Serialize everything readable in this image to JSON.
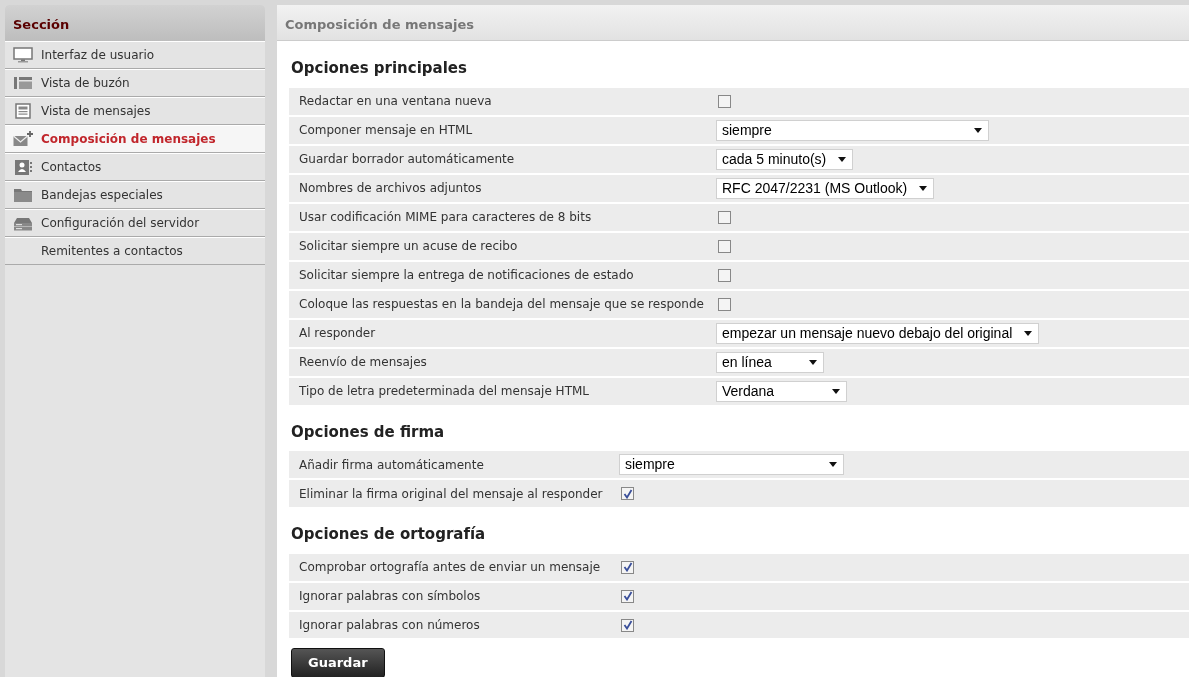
{
  "sidebar": {
    "title": "Sección",
    "items": [
      {
        "label": "Interfaz de usuario",
        "kind": "monitor",
        "selected": false
      },
      {
        "label": "Vista de buzón",
        "kind": "list",
        "selected": false
      },
      {
        "label": "Vista de mensajes",
        "kind": "document",
        "selected": false
      },
      {
        "label": "Composición de mensajes",
        "kind": "envelope",
        "selected": true
      },
      {
        "label": "Contactos",
        "kind": "contact",
        "selected": false
      },
      {
        "label": "Bandejas especiales",
        "kind": "folder",
        "selected": false
      },
      {
        "label": "Configuración del servidor",
        "kind": "server",
        "selected": false
      },
      {
        "label": "Remitentes a contactos",
        "selected": false
      }
    ]
  },
  "main": {
    "title": "Composición de mensajes",
    "sections": [
      {
        "title": "Opciones principales",
        "rows": [
          {
            "label": "Redactar en una ventana nueva",
            "kind": "checkbox",
            "checked": false
          },
          {
            "label": "Componer mensaje en HTML",
            "kind": "select",
            "value": "siempre"
          },
          {
            "label": "Guardar borrador automáticamente",
            "kind": "select",
            "value": "cada 5 minuto(s)"
          },
          {
            "label": "Nombres de archivos adjuntos",
            "kind": "select",
            "value": "RFC 2047/2231 (MS Outlook)"
          },
          {
            "label": "Usar codificación MIME para caracteres de 8 bits",
            "kind": "checkbox",
            "checked": false
          },
          {
            "label": "Solicitar siempre un acuse de recibo",
            "kind": "checkbox",
            "checked": false
          },
          {
            "label": "Solicitar siempre la entrega de notificaciones de estado",
            "kind": "checkbox",
            "checked": false
          },
          {
            "label": "Coloque las respuestas en la bandeja del mensaje que se responde",
            "kind": "checkbox",
            "checked": false
          },
          {
            "label": "Al responder",
            "kind": "select",
            "value": "empezar un mensaje nuevo debajo del original"
          },
          {
            "label": "Reenvío de mensajes",
            "kind": "select",
            "value": "en línea"
          },
          {
            "label": "Tipo de letra predeterminada del mensaje HTML",
            "kind": "select",
            "value": "Verdana"
          }
        ]
      },
      {
        "title": "Opciones de firma",
        "rows": [
          {
            "label": "Añadir firma automáticamente",
            "kind": "select",
            "value": "siempre"
          },
          {
            "label": "Eliminar la firma original del mensaje al responder",
            "kind": "checkbox",
            "checked": true
          }
        ]
      },
      {
        "title": "Opciones de ortografía",
        "rows": [
          {
            "label": "Comprobar ortografía antes de enviar un mensaje",
            "kind": "checkbox",
            "checked": true
          },
          {
            "label": "Ignorar palabras con símbolos",
            "kind": "checkbox",
            "checked": true
          },
          {
            "label": "Ignorar palabras con números",
            "kind": "checkbox",
            "checked": true
          }
        ]
      }
    ],
    "save_button": "Guardar"
  }
}
